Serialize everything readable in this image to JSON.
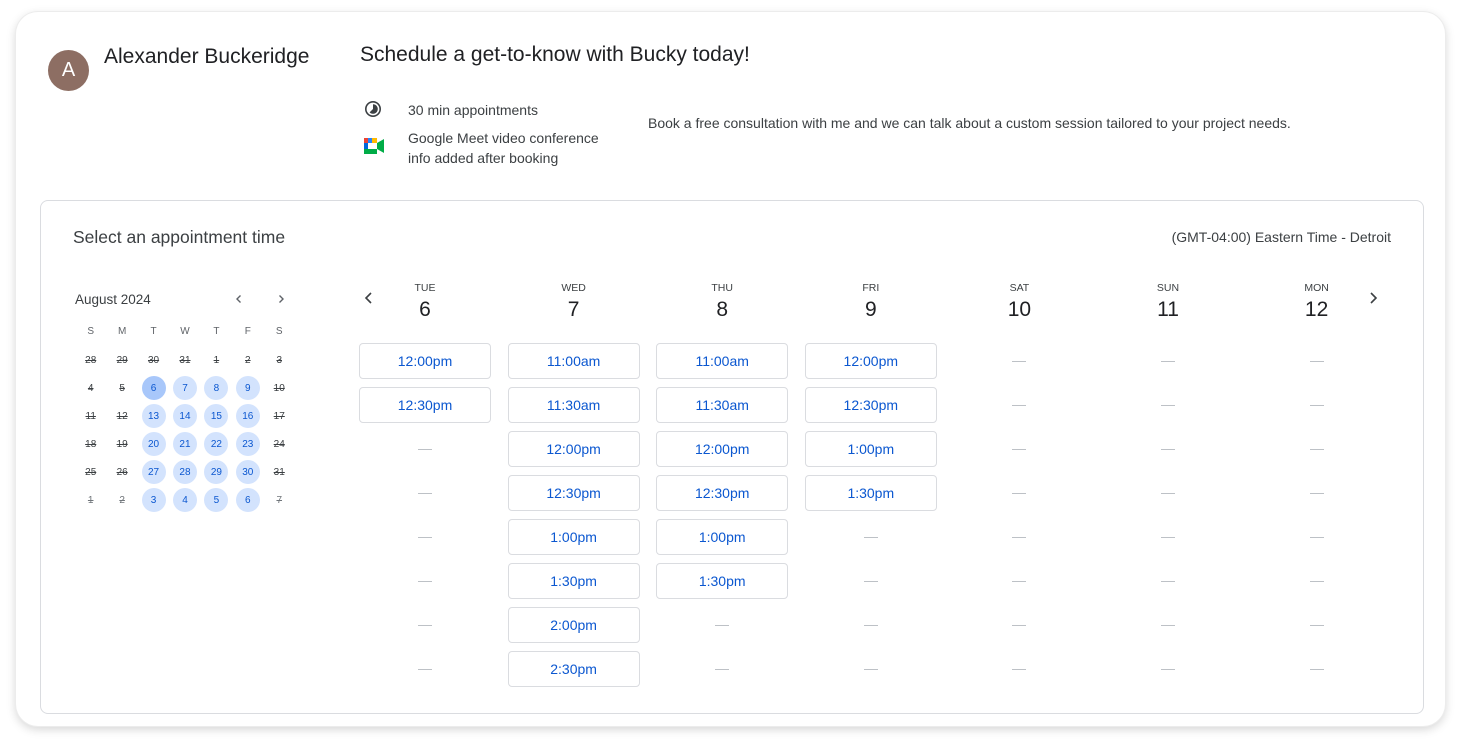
{
  "host": {
    "initial": "A",
    "name": "Alexander Buckeridge"
  },
  "title": "Schedule a get-to-know with Bucky today!",
  "duration": {
    "icon": "clock-icon",
    "text": "30 min appointments"
  },
  "meet": {
    "icon": "google-meet-icon",
    "line1": "Google Meet video conference",
    "line2": "info added after booking"
  },
  "description": "Book a free consultation with me and we can talk about a custom session tailored to your project needs.",
  "panel_title": "Select an appointment time",
  "timezone": "(GMT-04:00) Eastern Time - Detroit",
  "mini_calendar": {
    "month": "August 2024",
    "weekdays": [
      "S",
      "M",
      "T",
      "W",
      "T",
      "F",
      "S"
    ],
    "weeks": [
      [
        {
          "d": "28",
          "s": "na"
        },
        {
          "d": "29",
          "s": "na"
        },
        {
          "d": "30",
          "s": "na"
        },
        {
          "d": "31",
          "s": "na"
        },
        {
          "d": "1",
          "s": "na"
        },
        {
          "d": "2",
          "s": "na"
        },
        {
          "d": "3",
          "s": "na"
        }
      ],
      [
        {
          "d": "4",
          "s": "na"
        },
        {
          "d": "5",
          "s": "na"
        },
        {
          "d": "6",
          "s": "sel"
        },
        {
          "d": "7",
          "s": "av"
        },
        {
          "d": "8",
          "s": "av"
        },
        {
          "d": "9",
          "s": "av"
        },
        {
          "d": "10",
          "s": "na"
        }
      ],
      [
        {
          "d": "11",
          "s": "na"
        },
        {
          "d": "12",
          "s": "na"
        },
        {
          "d": "13",
          "s": "av"
        },
        {
          "d": "14",
          "s": "av"
        },
        {
          "d": "15",
          "s": "av"
        },
        {
          "d": "16",
          "s": "av"
        },
        {
          "d": "17",
          "s": "na"
        }
      ],
      [
        {
          "d": "18",
          "s": "na"
        },
        {
          "d": "19",
          "s": "na"
        },
        {
          "d": "20",
          "s": "av"
        },
        {
          "d": "21",
          "s": "av"
        },
        {
          "d": "22",
          "s": "av"
        },
        {
          "d": "23",
          "s": "av"
        },
        {
          "d": "24",
          "s": "na"
        }
      ],
      [
        {
          "d": "25",
          "s": "na"
        },
        {
          "d": "26",
          "s": "na"
        },
        {
          "d": "27",
          "s": "av"
        },
        {
          "d": "28",
          "s": "av"
        },
        {
          "d": "29",
          "s": "av"
        },
        {
          "d": "30",
          "s": "av"
        },
        {
          "d": "31",
          "s": "na"
        }
      ],
      [
        {
          "d": "1",
          "s": "na dim"
        },
        {
          "d": "2",
          "s": "na dim"
        },
        {
          "d": "3",
          "s": "av"
        },
        {
          "d": "4",
          "s": "av"
        },
        {
          "d": "5",
          "s": "av"
        },
        {
          "d": "6",
          "s": "av"
        },
        {
          "d": "7",
          "s": "na dim"
        }
      ]
    ]
  },
  "rows": 8,
  "days": [
    {
      "name": "TUE",
      "num": "6",
      "slots": [
        "12:00pm",
        "12:30pm"
      ]
    },
    {
      "name": "WED",
      "num": "7",
      "slots": [
        "11:00am",
        "11:30am",
        "12:00pm",
        "12:30pm",
        "1:00pm",
        "1:30pm",
        "2:00pm",
        "2:30pm"
      ]
    },
    {
      "name": "THU",
      "num": "8",
      "slots": [
        "11:00am",
        "11:30am",
        "12:00pm",
        "12:30pm",
        "1:00pm",
        "1:30pm"
      ]
    },
    {
      "name": "FRI",
      "num": "9",
      "slots": [
        "12:00pm",
        "12:30pm",
        "1:00pm",
        "1:30pm"
      ]
    },
    {
      "name": "SAT",
      "num": "10",
      "slots": []
    },
    {
      "name": "SUN",
      "num": "11",
      "slots": []
    },
    {
      "name": "MON",
      "num": "12",
      "slots": []
    }
  ]
}
